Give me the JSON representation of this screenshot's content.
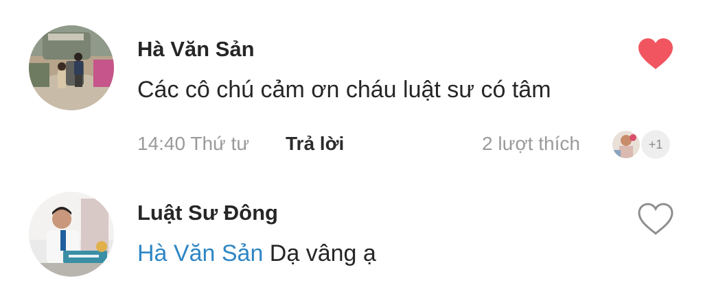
{
  "comments": [
    {
      "author": "Hà Văn Sản",
      "text": "Các cô chú cảm ơn cháu luật sư có tâm",
      "time": "14:40 Thứ tư",
      "reply_label": "Trả lời",
      "likes_text": "2 lượt thích",
      "extra_likers": "+1",
      "liked": true,
      "heart_icon": "heart-filled-icon"
    },
    {
      "author": "Luật Sư Đông",
      "mention": "Hà Văn Sản",
      "text": " Dạ vâng ạ",
      "liked": false,
      "heart_icon": "heart-outline-icon"
    }
  ],
  "colors": {
    "heart_filled": "#f05560",
    "mention": "#2d86c4",
    "meta_text": "#9a9a9a",
    "heart_outline": "#8f8f8f"
  }
}
